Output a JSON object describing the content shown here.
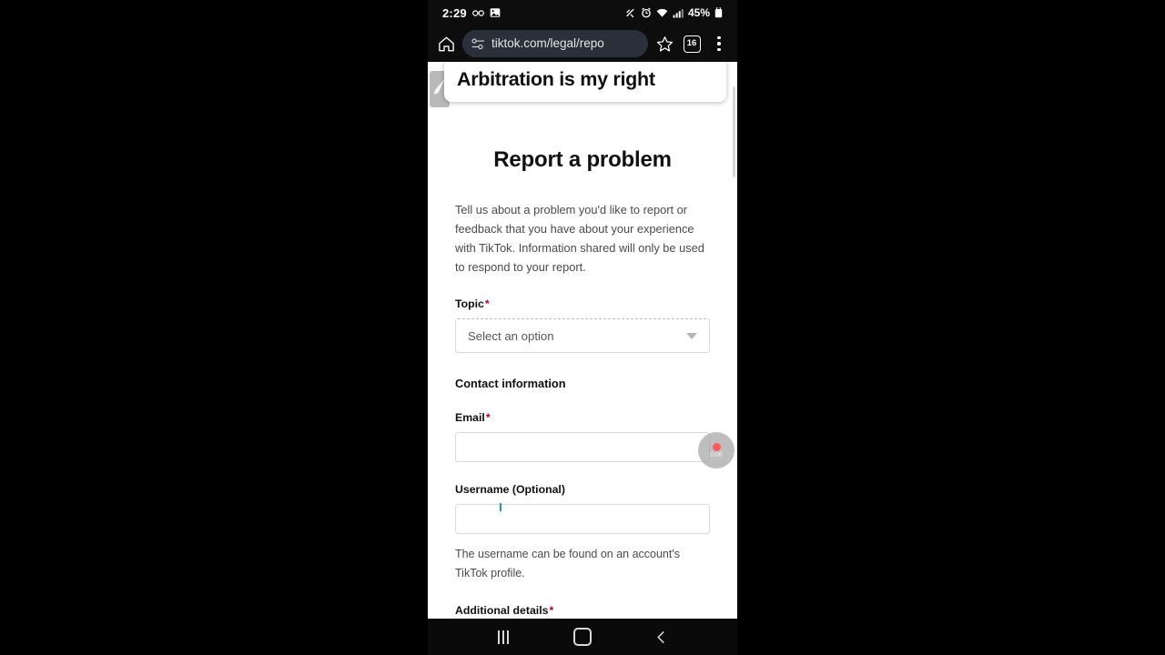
{
  "status_bar": {
    "clock": "2:29",
    "battery_percent": "45%",
    "icons": [
      "glasses-icon",
      "image-icon",
      "silent-mode-icon",
      "alarm-icon",
      "wifi-icon",
      "cellular-signal-icon",
      "battery-icon"
    ]
  },
  "browser": {
    "home_icon": "home-icon",
    "site_info_icon": "site-settings-icon",
    "url": "tiktok.com/legal/repo",
    "bookmark_icon": "star-icon",
    "tab_count": "16",
    "menu_icon": "kebab-menu-icon"
  },
  "overlay": {
    "title": "Arbitration is my right",
    "handle_icon": "edit-pen-icon"
  },
  "page": {
    "title": "Report a problem",
    "intro": "Tell us about a problem you'd like to report or feedback that you have about your experience with TikTok. Information shared will only be used to respond to your report.",
    "topic": {
      "label": "Topic",
      "required_marker": "*",
      "selected_value": "Select an option",
      "caret_icon": "chevron-down-icon"
    },
    "contact_section": {
      "heading": "Contact information"
    },
    "email": {
      "label": "Email",
      "required_marker": "*",
      "value": "",
      "placeholder": ""
    },
    "username": {
      "label": "Username (Optional)",
      "value": "",
      "placeholder": "",
      "helper": "The username can be found on an account's TikTok profile."
    },
    "additional_details": {
      "label": "Additional details",
      "required_marker": "*"
    }
  },
  "screen_recorder": {
    "timer": "0:06",
    "record_icon": "record-dot-icon"
  },
  "navbar": {
    "recents_label": "recents-icon",
    "home_label": "home-icon",
    "back_label": "back-icon"
  },
  "colors": {
    "required_red": "#b3002f",
    "record_red": "#ff5a5f",
    "omnibox_bg": "#2a3039"
  }
}
